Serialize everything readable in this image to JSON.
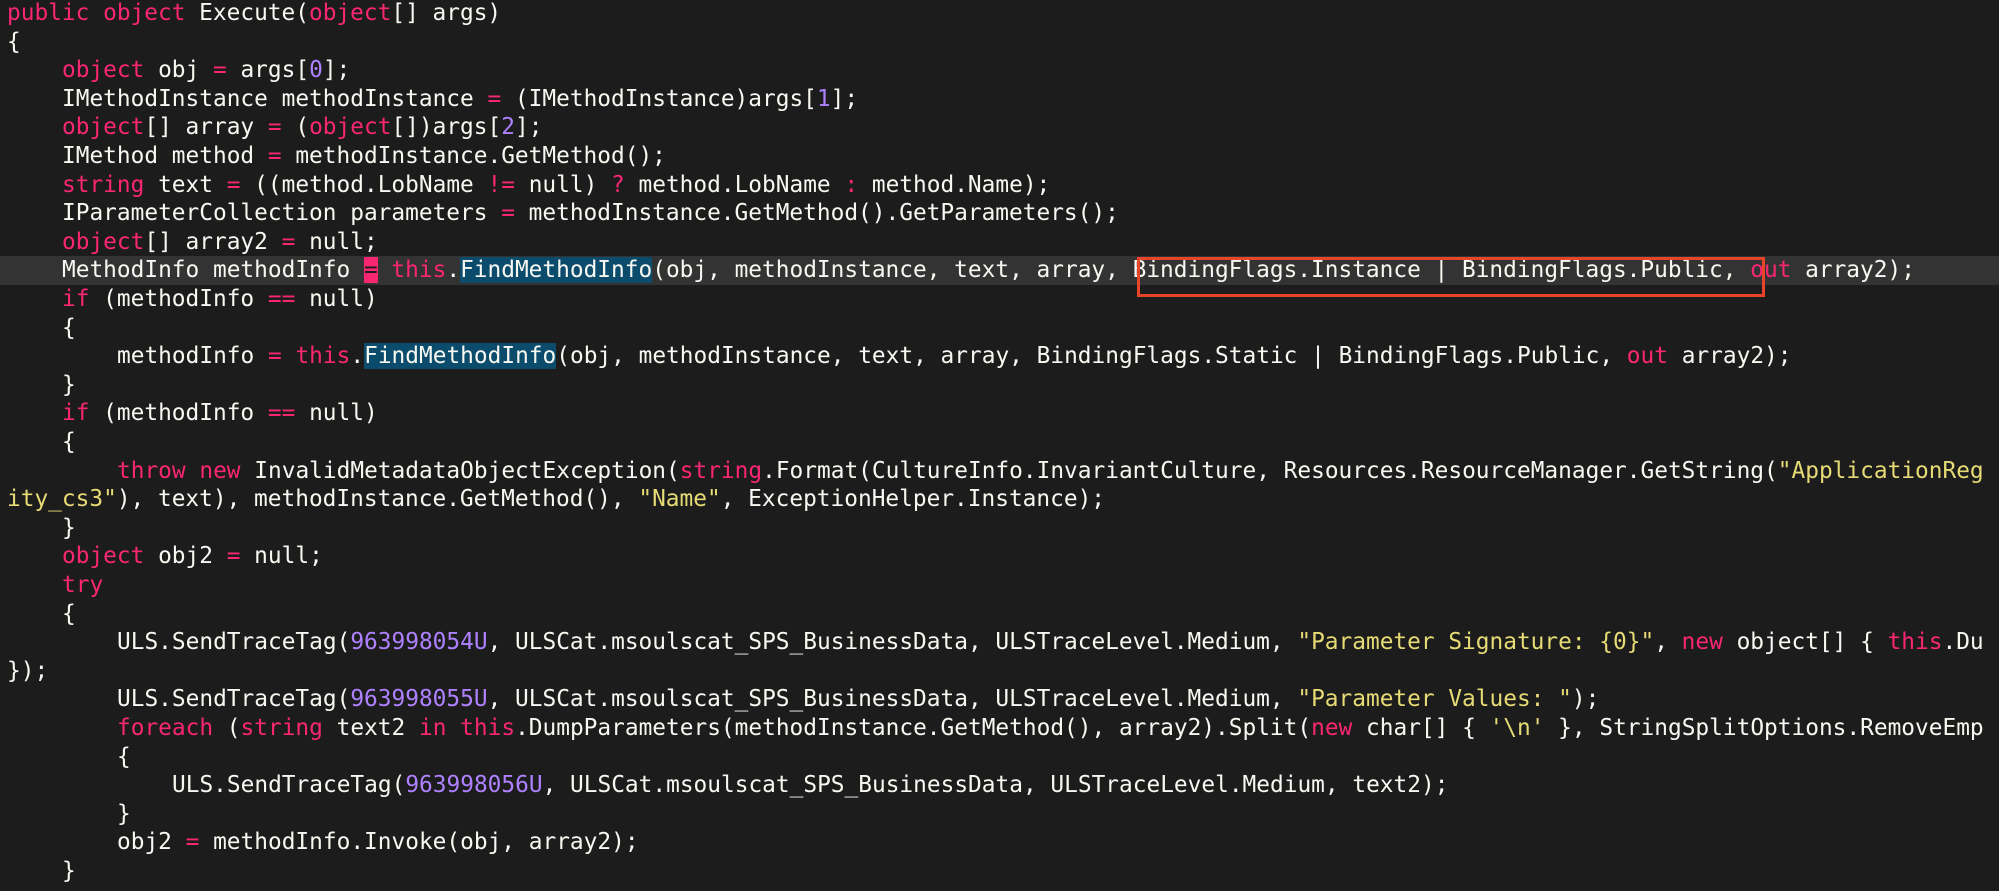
{
  "editor": {
    "highlight_color": "#e8442a",
    "current_line_index": 9,
    "lines": [
      {
        "indent": 0,
        "tokens": [
          [
            "kw",
            "public"
          ],
          [
            "id",
            " "
          ],
          [
            "kw",
            "object"
          ],
          [
            "id",
            " Execute("
          ],
          [
            "kw",
            "object"
          ],
          [
            "id",
            "[] args)"
          ]
        ]
      },
      {
        "indent": 0,
        "tokens": [
          [
            "punc",
            "{"
          ]
        ]
      },
      {
        "indent": 1,
        "tokens": [
          [
            "kw",
            "object"
          ],
          [
            "id",
            " obj "
          ],
          [
            "op",
            "="
          ],
          [
            "id",
            " args["
          ],
          [
            "num",
            "0"
          ],
          [
            "id",
            "];"
          ]
        ]
      },
      {
        "indent": 1,
        "tokens": [
          [
            "id",
            "IMethodInstance methodInstance "
          ],
          [
            "op",
            "="
          ],
          [
            "id",
            " (IMethodInstance)args["
          ],
          [
            "num",
            "1"
          ],
          [
            "id",
            "];"
          ]
        ]
      },
      {
        "indent": 1,
        "tokens": [
          [
            "kw",
            "object"
          ],
          [
            "id",
            "[] array "
          ],
          [
            "op",
            "="
          ],
          [
            "id",
            " ("
          ],
          [
            "kw",
            "object"
          ],
          [
            "id",
            "[])args["
          ],
          [
            "num",
            "2"
          ],
          [
            "id",
            "];"
          ]
        ]
      },
      {
        "indent": 1,
        "tokens": [
          [
            "id",
            "IMethod method "
          ],
          [
            "op",
            "="
          ],
          [
            "id",
            " methodInstance.GetMethod();"
          ]
        ]
      },
      {
        "indent": 1,
        "tokens": [
          [
            "kw",
            "string"
          ],
          [
            "id",
            " text "
          ],
          [
            "op",
            "="
          ],
          [
            "id",
            " ((method.LobName "
          ],
          [
            "op",
            "!="
          ],
          [
            "id",
            " null) "
          ],
          [
            "op",
            "?"
          ],
          [
            "id",
            " method.LobName "
          ],
          [
            "op",
            ":"
          ],
          [
            "id",
            " method.Name);"
          ]
        ]
      },
      {
        "indent": 1,
        "tokens": [
          [
            "id",
            "IParameterCollection parameters "
          ],
          [
            "op",
            "="
          ],
          [
            "id",
            " methodInstance.GetMethod().GetParameters();"
          ]
        ]
      },
      {
        "indent": 1,
        "tokens": [
          [
            "kw",
            "object"
          ],
          [
            "id",
            "[] array2 "
          ],
          [
            "op",
            "="
          ],
          [
            "id",
            " null;"
          ]
        ]
      },
      {
        "indent": 1,
        "tokens": [
          [
            "id",
            "MethodInfo methodInfo "
          ],
          [
            "caret",
            "="
          ],
          [
            "id",
            " "
          ],
          [
            "kw",
            "this"
          ],
          [
            "id",
            "."
          ],
          [
            "match",
            "FindMethodInfo"
          ],
          [
            "id",
            "(obj, methodInstance, text, array, BindingFlags.Instance | BindingFlags.Public, "
          ],
          [
            "kw",
            "out"
          ],
          [
            "id",
            " array2);"
          ]
        ]
      },
      {
        "indent": 1,
        "tokens": [
          [
            "kw",
            "if"
          ],
          [
            "id",
            " (methodInfo "
          ],
          [
            "op",
            "=="
          ],
          [
            "id",
            " null)"
          ]
        ]
      },
      {
        "indent": 1,
        "tokens": [
          [
            "punc",
            "{"
          ]
        ]
      },
      {
        "indent": 2,
        "tokens": [
          [
            "id",
            "methodInfo "
          ],
          [
            "op",
            "="
          ],
          [
            "id",
            " "
          ],
          [
            "kw",
            "this"
          ],
          [
            "id",
            "."
          ],
          [
            "match",
            "FindMethodInfo"
          ],
          [
            "id",
            "(obj, methodInstance, text, array, BindingFlags.Static | BindingFlags.Public, "
          ],
          [
            "kw",
            "out"
          ],
          [
            "id",
            " array2);"
          ]
        ]
      },
      {
        "indent": 1,
        "tokens": [
          [
            "punc",
            "}"
          ]
        ]
      },
      {
        "indent": 1,
        "tokens": [
          [
            "kw",
            "if"
          ],
          [
            "id",
            " (methodInfo "
          ],
          [
            "op",
            "=="
          ],
          [
            "id",
            " null)"
          ]
        ]
      },
      {
        "indent": 1,
        "tokens": [
          [
            "punc",
            "{"
          ]
        ]
      },
      {
        "indent": 2,
        "tokens": [
          [
            "kw",
            "throw"
          ],
          [
            "id",
            " "
          ],
          [
            "kw",
            "new"
          ],
          [
            "id",
            " InvalidMetadataObjectException("
          ],
          [
            "kw",
            "string"
          ],
          [
            "id",
            ".Format(CultureInfo.InvariantCulture, Resources.ResourceManager.GetString("
          ],
          [
            "str",
            "\"ApplicationReg"
          ]
        ]
      },
      {
        "indent": 0,
        "tokens": [
          [
            "str",
            "ity_cs3\""
          ],
          [
            "id",
            "), text), methodInstance.GetMethod(), "
          ],
          [
            "str",
            "\"Name\""
          ],
          [
            "id",
            ", ExceptionHelper.Instance);"
          ]
        ]
      },
      {
        "indent": 1,
        "tokens": [
          [
            "punc",
            "}"
          ]
        ]
      },
      {
        "indent": 1,
        "tokens": [
          [
            "kw",
            "object"
          ],
          [
            "id",
            " obj2 "
          ],
          [
            "op",
            "="
          ],
          [
            "id",
            " null;"
          ]
        ]
      },
      {
        "indent": 1,
        "tokens": [
          [
            "kw",
            "try"
          ]
        ]
      },
      {
        "indent": 1,
        "tokens": [
          [
            "punc",
            "{"
          ]
        ]
      },
      {
        "indent": 2,
        "tokens": [
          [
            "id",
            "ULS.SendTraceTag("
          ],
          [
            "num",
            "963998054U"
          ],
          [
            "id",
            ", ULSCat.msoulscat_SPS_BusinessData, ULSTraceLevel.Medium, "
          ],
          [
            "str",
            "\"Parameter Signature: {0}\""
          ],
          [
            "id",
            ", "
          ],
          [
            "kw",
            "new"
          ],
          [
            "id",
            " object[] { "
          ],
          [
            "kw",
            "this"
          ],
          [
            "id",
            ".Du"
          ]
        ]
      },
      {
        "indent": 0,
        "tokens": [
          [
            "id",
            "});"
          ]
        ]
      },
      {
        "indent": 2,
        "tokens": [
          [
            "id",
            "ULS.SendTraceTag("
          ],
          [
            "num",
            "963998055U"
          ],
          [
            "id",
            ", ULSCat.msoulscat_SPS_BusinessData, ULSTraceLevel.Medium, "
          ],
          [
            "str",
            "\"Parameter Values: \""
          ],
          [
            "id",
            ");"
          ]
        ]
      },
      {
        "indent": 2,
        "tokens": [
          [
            "kw",
            "foreach"
          ],
          [
            "id",
            " ("
          ],
          [
            "kw",
            "string"
          ],
          [
            "id",
            " text2 "
          ],
          [
            "kw",
            "in"
          ],
          [
            "id",
            " "
          ],
          [
            "kw",
            "this"
          ],
          [
            "id",
            ".DumpParameters(methodInstance.GetMethod(), array2).Split("
          ],
          [
            "kw",
            "new"
          ],
          [
            "id",
            " char[] { "
          ],
          [
            "str",
            "'\\n'"
          ],
          [
            "id",
            " }, StringSplitOptions.RemoveEmp"
          ]
        ]
      },
      {
        "indent": 2,
        "tokens": [
          [
            "punc",
            "{"
          ]
        ]
      },
      {
        "indent": 3,
        "tokens": [
          [
            "id",
            "ULS.SendTraceTag("
          ],
          [
            "num",
            "963998056U"
          ],
          [
            "id",
            ", ULSCat.msoulscat_SPS_BusinessData, ULSTraceLevel.Medium, text2);"
          ]
        ]
      },
      {
        "indent": 2,
        "tokens": [
          [
            "punc",
            "}"
          ]
        ]
      },
      {
        "indent": 2,
        "tokens": [
          [
            "id",
            "obj2 "
          ],
          [
            "op",
            "="
          ],
          [
            "id",
            " methodInfo.Invoke(obj, array2);"
          ]
        ]
      },
      {
        "indent": 1,
        "tokens": [
          [
            "punc",
            "}"
          ]
        ]
      }
    ]
  }
}
